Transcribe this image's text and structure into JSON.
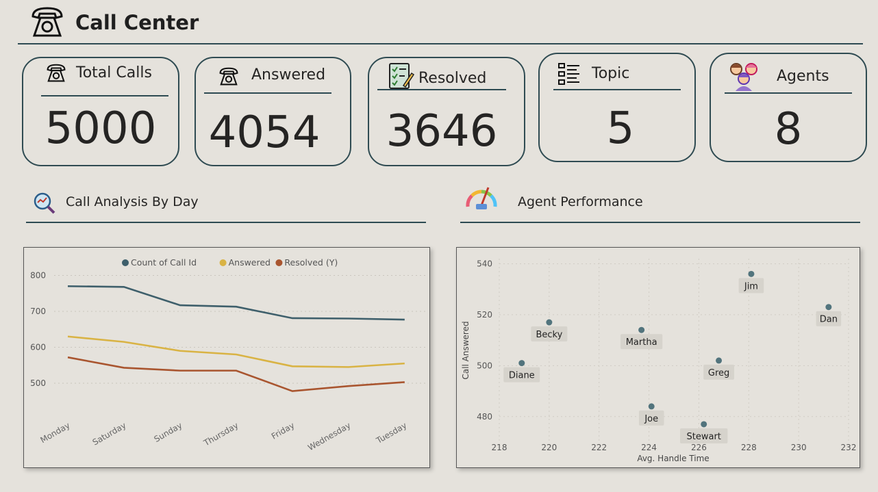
{
  "header": {
    "title": "Call Center"
  },
  "kpis": [
    {
      "label": "Total Calls",
      "value": "5000",
      "icon": "telephone-icon"
    },
    {
      "label": "Answered",
      "value": "4054",
      "icon": "telephone-icon"
    },
    {
      "label": "Resolved",
      "value": "3646",
      "icon": "checklist-icon"
    },
    {
      "label": "Topic",
      "value": "5",
      "icon": "list-icon"
    },
    {
      "label": "Agents",
      "value": "8",
      "icon": "agents-icon"
    }
  ],
  "sections": {
    "day": {
      "title": "Call Analysis By Day"
    },
    "agent": {
      "title": "Agent Performance"
    }
  },
  "colors": {
    "accent": "#2f4b52",
    "count": "#3e5f6b",
    "answered": "#d9b344",
    "resolved": "#a9552f"
  },
  "chart_data": [
    {
      "type": "line",
      "categories": [
        "Monday",
        "Saturday",
        "Sunday",
        "Thursday",
        "Friday",
        "Wednesday",
        "Tuesday"
      ],
      "series": [
        {
          "name": "Count of Call Id",
          "values": [
            770,
            768,
            717,
            713,
            681,
            680,
            677
          ]
        },
        {
          "name": "Answered",
          "values": [
            630,
            615,
            590,
            580,
            547,
            545,
            555
          ]
        },
        {
          "name": "Resolved (Y)",
          "values": [
            572,
            543,
            535,
            535,
            478,
            492,
            503
          ]
        }
      ],
      "ylim": [
        420,
        820
      ],
      "yticks": [
        500,
        600,
        700,
        800
      ],
      "legend": "top-center",
      "grid": true
    },
    {
      "type": "scatter",
      "xlabel": "Avg. Handle Time",
      "ylabel": "Call Answered",
      "xlim": [
        218,
        232
      ],
      "ylim": [
        470,
        542
      ],
      "xticks": [
        218,
        220,
        222,
        224,
        226,
        228,
        230,
        232
      ],
      "yticks": [
        480,
        500,
        520,
        540
      ],
      "points": [
        {
          "label": "Diane",
          "x": 218.9,
          "y": 501
        },
        {
          "label": "Becky",
          "x": 220.0,
          "y": 517
        },
        {
          "label": "Martha",
          "x": 223.7,
          "y": 514
        },
        {
          "label": "Joe",
          "x": 224.1,
          "y": 484
        },
        {
          "label": "Greg",
          "x": 226.8,
          "y": 502
        },
        {
          "label": "Stewart",
          "x": 226.2,
          "y": 477
        },
        {
          "label": "Jim",
          "x": 228.1,
          "y": 536
        },
        {
          "label": "Dan",
          "x": 231.2,
          "y": 523
        }
      ],
      "grid": true
    }
  ]
}
